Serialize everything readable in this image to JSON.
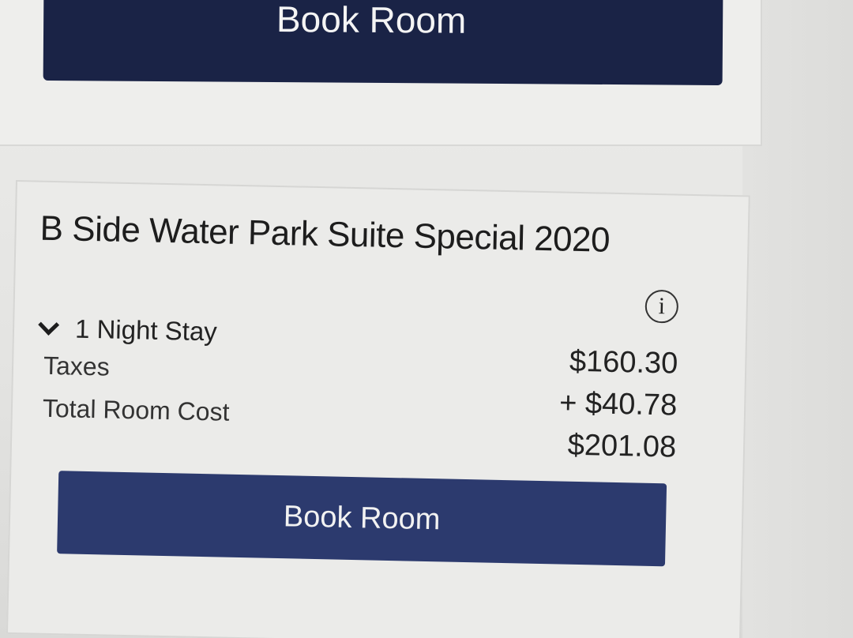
{
  "top_card": {
    "book_button_label": "Book Room"
  },
  "room": {
    "title": "B Side Water Park Suite Special 2020",
    "stay_label": "1 Night Stay",
    "taxes_label": "Taxes",
    "total_label": "Total Room Cost",
    "nightly_price": "$160.30",
    "taxes_amount": "+ $40.78",
    "total_cost": "$201.08",
    "info_icon_glyph": "i",
    "book_button_label": "Book Room"
  },
  "colors": {
    "button_top": "#1a2346",
    "button_main": "#2c3a6e",
    "background": "#e6e6e4"
  },
  "icons": {
    "info": "info-icon",
    "expand": "chevron-down-icon"
  }
}
